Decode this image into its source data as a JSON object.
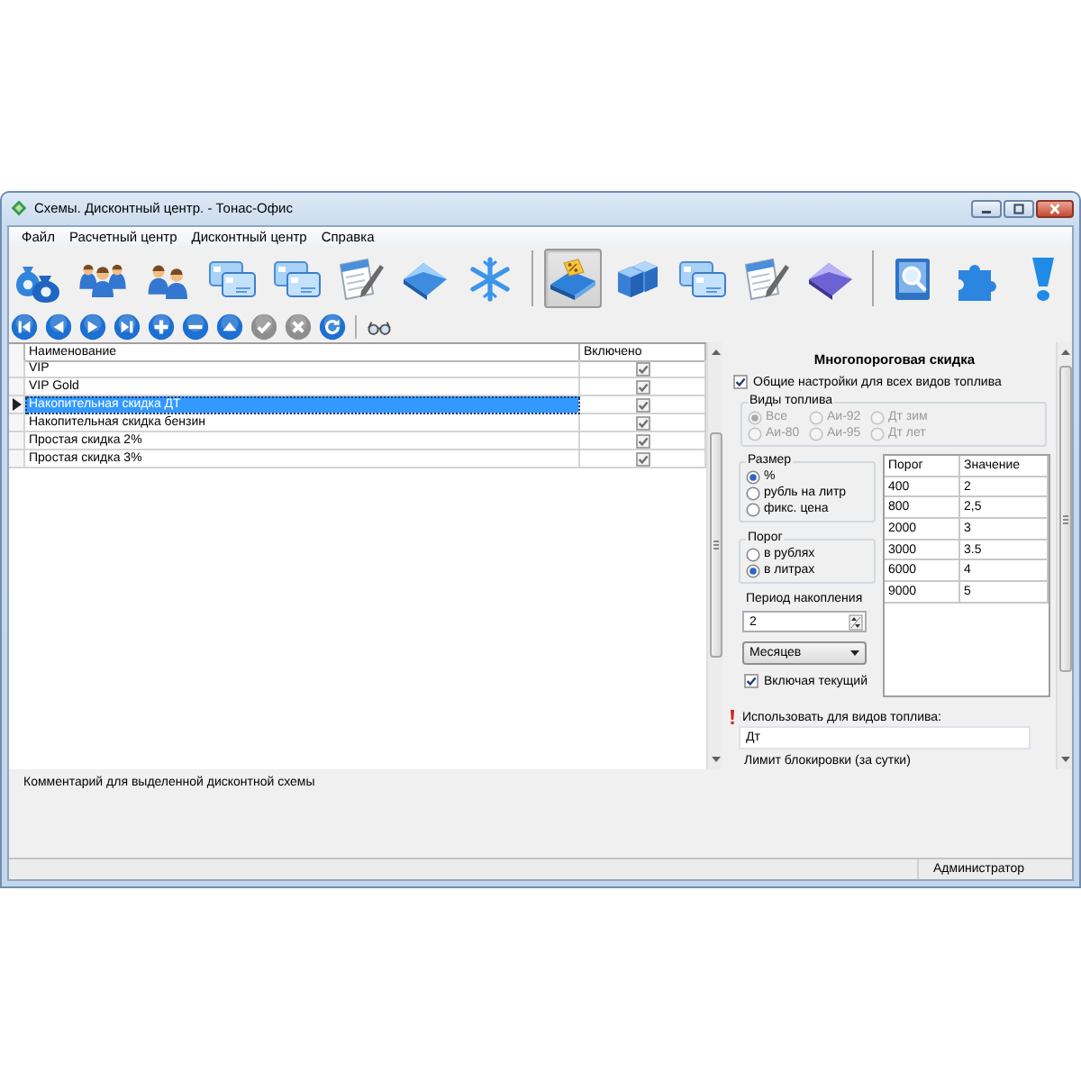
{
  "window": {
    "title": "Схемы. Дисконтный центр. - Тонас-Офис"
  },
  "menu": [
    "Файл",
    "Расчетный центр",
    "Дисконтный центр",
    "Справка"
  ],
  "toolbar_groups": [
    [
      {
        "selected": false
      },
      {
        "selected": false
      },
      {
        "selected": false
      },
      {
        "selected": false
      },
      {
        "selected": false
      },
      {
        "selected": false
      },
      {
        "selected": false
      },
      {
        "selected": false
      }
    ],
    [
      {
        "selected": true
      },
      {
        "selected": false
      },
      {
        "selected": false
      },
      {
        "selected": false
      },
      {
        "selected": false
      }
    ],
    [
      {
        "selected": false
      },
      {
        "selected": false
      },
      {
        "selected": false
      }
    ]
  ],
  "nav_groups": [
    [
      {
        "disabled": false
      },
      {
        "disabled": false
      },
      {
        "disabled": false
      },
      {
        "disabled": false
      },
      {
        "disabled": false
      },
      {
        "disabled": false
      },
      {
        "disabled": false
      },
      {
        "disabled": true
      },
      {
        "disabled": true
      },
      {
        "disabled": false
      }
    ],
    [
      {
        "disabled": false
      }
    ]
  ],
  "schemes_table": {
    "columns": [
      "Наименование",
      "Включено"
    ],
    "rows": [
      {
        "name": "VIP",
        "enabled": true,
        "selected": false
      },
      {
        "name": "VIP Gold",
        "enabled": true,
        "selected": false
      },
      {
        "name": "Накопительная скидка ДТ",
        "enabled": true,
        "selected": true
      },
      {
        "name": "Накопительная скидка бензин",
        "enabled": true,
        "selected": false
      },
      {
        "name": "Простая скидка 2%",
        "enabled": true,
        "selected": false
      },
      {
        "name": "Простая скидка 3%",
        "enabled": true,
        "selected": false
      }
    ]
  },
  "discount_panel": {
    "title": "Многопороговая скидка",
    "common_settings": {
      "label": "Общие настройки для всех видов топлива",
      "checked": true
    },
    "fuel_types": {
      "title": "Виды топлива",
      "disabled": true,
      "options": [
        {
          "label": "Все",
          "selected": true
        },
        {
          "label": "Аи-92",
          "selected": false
        },
        {
          "label": "Дт зим",
          "selected": false
        },
        {
          "label": "Аи-80",
          "selected": false
        },
        {
          "label": "Аи-95",
          "selected": false
        },
        {
          "label": "Дт лет",
          "selected": false
        }
      ]
    },
    "size": {
      "title": "Размер",
      "options": [
        {
          "label": "%",
          "selected": true
        },
        {
          "label": "рубль на литр",
          "selected": false
        },
        {
          "label": "фикс. цена",
          "selected": false
        }
      ]
    },
    "threshold": {
      "title": "Порог",
      "options": [
        {
          "label": "в рублях",
          "selected": false
        },
        {
          "label": "в литрах",
          "selected": true
        }
      ]
    },
    "period": {
      "label": "Период накопления",
      "value": "2",
      "unit": "Месяцев",
      "include_current": {
        "label": "Включая текущий",
        "checked": true
      }
    },
    "thresholds_table": {
      "columns": [
        "Порог",
        "Значение"
      ],
      "rows": [
        [
          "400",
          "2"
        ],
        [
          "800",
          "2,5"
        ],
        [
          "2000",
          "3"
        ],
        [
          "3000",
          "3.5"
        ],
        [
          "6000",
          "4"
        ],
        [
          "9000",
          "5"
        ]
      ]
    },
    "fuel_usage": {
      "label": "Использовать для видов топлива:",
      "value": "Дт"
    },
    "block_limit": {
      "label": "Лимит блокировки (за сутки)"
    }
  },
  "comment": {
    "label": "Комментарий для выделенной дисконтной схемы"
  },
  "status_bar": {
    "user": "Администратор"
  }
}
